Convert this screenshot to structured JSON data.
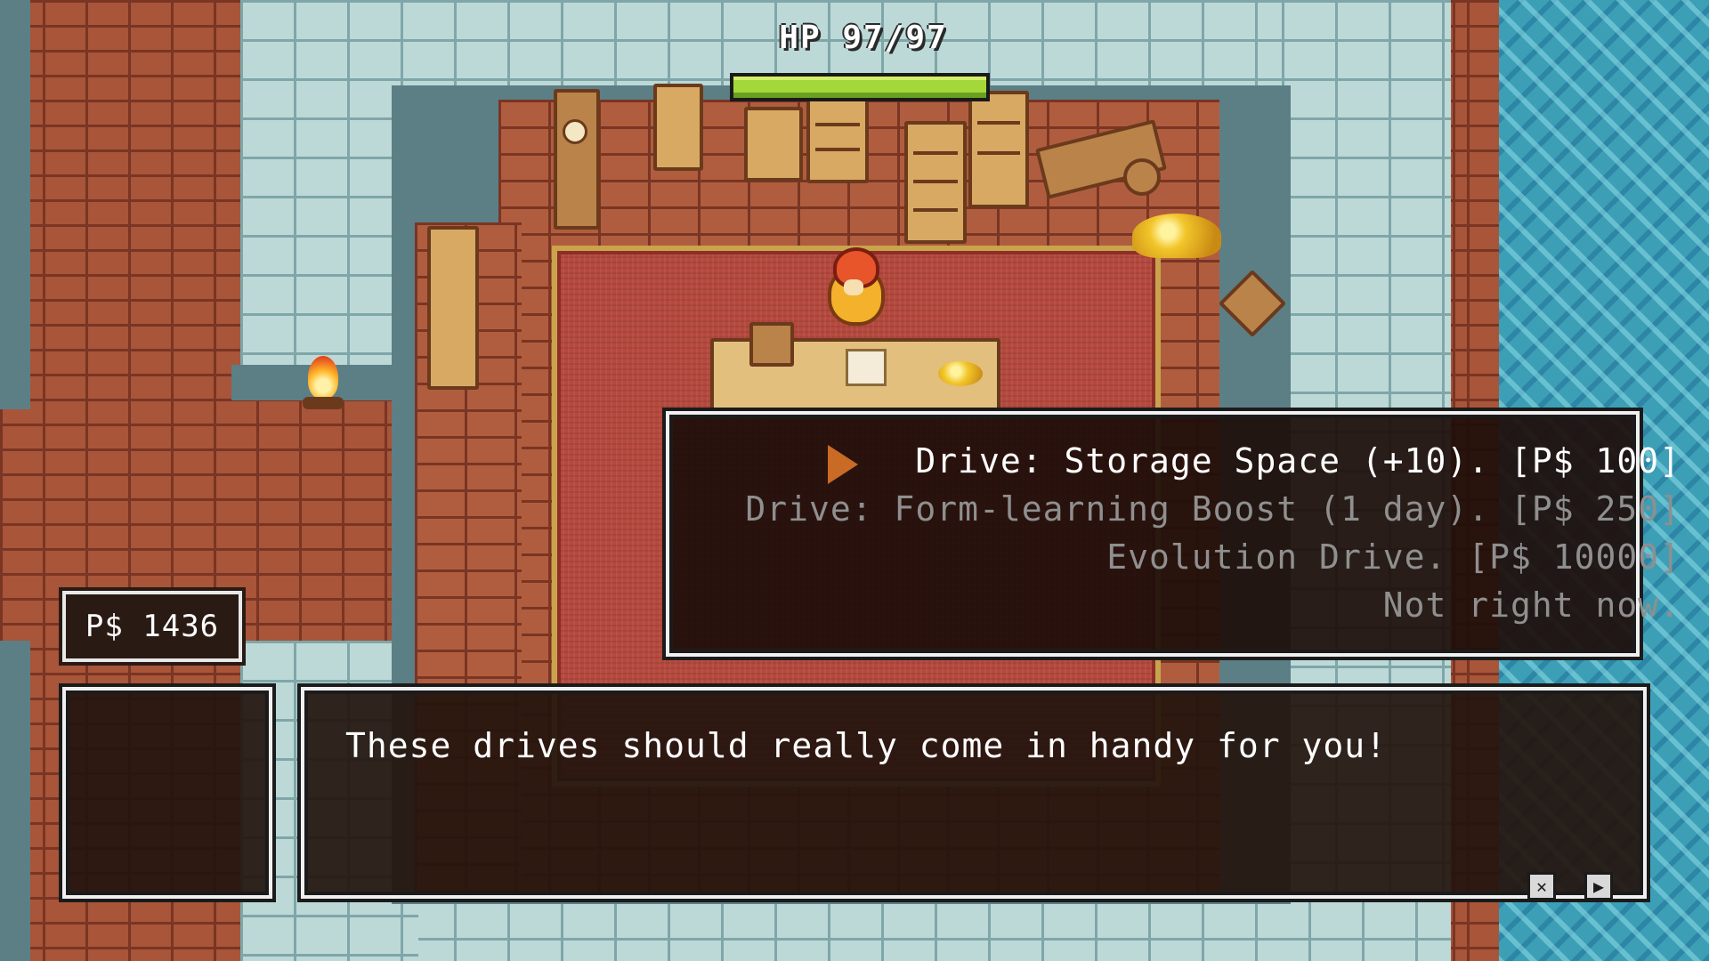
{
  "hud": {
    "hp_label": "HP 97/97",
    "hp_current": 97,
    "hp_max": 97,
    "money": "P$ 1436"
  },
  "shop_menu": {
    "options": [
      {
        "label": "Drive: Storage Space (+10). [P$ 100]",
        "selected": true
      },
      {
        "label": "Drive: Form-learning Boost (1 day). [P$ 250]",
        "selected": false
      },
      {
        "label": "Evolution Drive. [P$ 10000]",
        "selected": false
      },
      {
        "label": "Not right now.",
        "selected": false
      }
    ]
  },
  "dialog": {
    "text": "These drives should really come in handy for you!"
  },
  "colors": {
    "hp_fill": "#a4d83a",
    "selected_text": "#ffffff",
    "dim_text": "#8f8f8f",
    "box_border": "#f0f0f0"
  },
  "icons": {
    "close_control": "close-icon",
    "advance_control": "play-icon",
    "menu_cursor": "arrow-cursor-icon"
  }
}
